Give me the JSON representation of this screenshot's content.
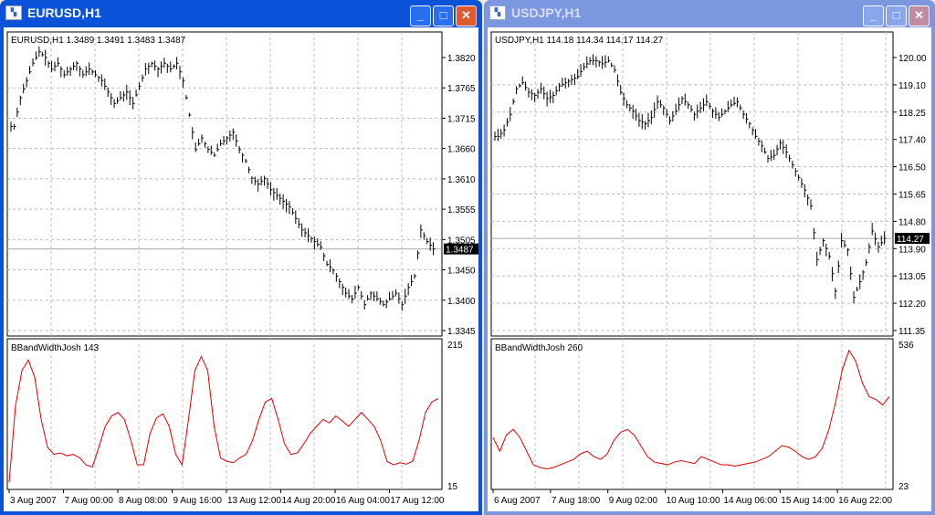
{
  "windows": [
    {
      "title": "EURUSD,H1",
      "header": "EURUSD,H1  1.3489 1.3491 1.3483 1.3487",
      "current_price": "1.3487",
      "current_value": 1.3487,
      "price_ticks": [
        "1.3820",
        "1.3765",
        "1.3715",
        "1.3660",
        "1.3610",
        "1.3555",
        "1.3505",
        "1.3450",
        "1.3400",
        "1.3345"
      ],
      "indicator_label": "BBandWidthJosh 143",
      "indicator_ticks": [
        "215",
        "15"
      ],
      "time_labels": [
        "3 Aug 2007",
        "7 Aug 00:00",
        "8 Aug 08:00",
        "9 Aug 16:00",
        "13 Aug 12:00",
        "14 Aug 20:00",
        "16 Aug 04:00",
        "17 Aug 12:00"
      ]
    },
    {
      "title": "USDJPY,H1",
      "header": "USDJPY,H1  114.18 114.34 114.17 114.27",
      "current_price": "114.27",
      "current_value": 114.27,
      "price_ticks": [
        "120.00",
        "119.10",
        "118.25",
        "117.40",
        "116.50",
        "115.65",
        "114.80",
        "113.90",
        "113.05",
        "112.20",
        "111.35"
      ],
      "indicator_label": "BBandWidthJosh 260",
      "indicator_ticks": [
        "536",
        "23"
      ],
      "time_labels": [
        "6 Aug 2007",
        "7 Aug 18:00",
        "9 Aug 02:00",
        "10 Aug 10:00",
        "14 Aug 06:00",
        "15 Aug 14:00",
        "16 Aug 22:00"
      ]
    }
  ],
  "chart_data": [
    {
      "type": "ohlc",
      "symbol": "EURUSD",
      "ylim": [
        1.3345,
        1.382
      ],
      "closes": [
        1.37,
        1.375,
        1.378,
        1.381,
        1.383,
        1.382,
        1.38,
        1.381,
        1.379,
        1.38,
        1.381,
        1.379,
        1.38,
        1.379,
        1.378,
        1.376,
        1.374,
        1.375,
        1.376,
        1.374,
        1.377,
        1.38,
        1.381,
        1.38,
        1.381,
        1.38,
        1.381,
        1.378,
        1.372,
        1.366,
        1.368,
        1.366,
        1.365,
        1.367,
        1.368,
        1.369,
        1.366,
        1.364,
        1.361,
        1.36,
        1.361,
        1.359,
        1.358,
        1.357,
        1.356,
        1.354,
        1.352,
        1.351,
        1.35,
        1.349,
        1.346,
        1.345,
        1.343,
        1.341,
        1.34,
        1.342,
        1.339,
        1.341,
        1.34,
        1.339,
        1.34,
        1.341,
        1.339,
        1.342,
        1.344,
        1.352,
        1.35,
        1.3487
      ],
      "indicator": {
        "ylim": [
          15,
          215
        ],
        "values": [
          20,
          130,
          180,
          195,
          170,
          110,
          70,
          60,
          62,
          58,
          60,
          55,
          45,
          42,
          70,
          100,
          115,
          120,
          110,
          80,
          45,
          45,
          90,
          112,
          118,
          100,
          60,
          45,
          110,
          180,
          200,
          180,
          100,
          55,
          50,
          48,
          55,
          60,
          80,
          110,
          135,
          140,
          110,
          75,
          60,
          62,
          75,
          90,
          100,
          110,
          105,
          115,
          108,
          100,
          110,
          120,
          110,
          100,
          80,
          50,
          45,
          48,
          46,
          50,
          80,
          120,
          135,
          140
        ]
      }
    },
    {
      "type": "ohlc",
      "symbol": "USDJPY",
      "ylim": [
        111.35,
        120.0
      ],
      "closes": [
        117.5,
        117.7,
        118.2,
        119.0,
        119.2,
        118.9,
        118.8,
        119.0,
        118.7,
        118.8,
        119.1,
        119.2,
        119.3,
        119.4,
        119.7,
        119.9,
        119.9,
        119.8,
        119.9,
        119.6,
        118.9,
        118.5,
        118.3,
        118.0,
        117.9,
        118.1,
        118.6,
        118.4,
        118.0,
        118.3,
        118.7,
        118.5,
        118.2,
        118.4,
        118.6,
        118.3,
        118.1,
        118.3,
        118.5,
        118.6,
        118.2,
        117.9,
        117.5,
        117.2,
        116.8,
        116.9,
        117.3,
        117.0,
        116.6,
        116.2,
        115.8,
        115.3,
        113.6,
        114.2,
        113.7,
        112.6,
        114.2,
        113.9,
        112.4,
        112.9,
        113.5,
        114.5,
        114.0,
        114.27
      ],
      "indicator": {
        "ylim": [
          23,
          536
        ],
        "values": [
          200,
          150,
          210,
          230,
          200,
          150,
          100,
          90,
          85,
          90,
          100,
          110,
          120,
          140,
          150,
          130,
          120,
          140,
          190,
          220,
          230,
          210,
          170,
          130,
          110,
          105,
          100,
          110,
          115,
          110,
          105,
          130,
          120,
          110,
          100,
          100,
          95,
          100,
          105,
          110,
          120,
          130,
          150,
          170,
          165,
          150,
          130,
          120,
          130,
          160,
          230,
          330,
          450,
          520,
          480,
          400,
          350,
          340,
          320,
          350
        ]
      }
    }
  ]
}
